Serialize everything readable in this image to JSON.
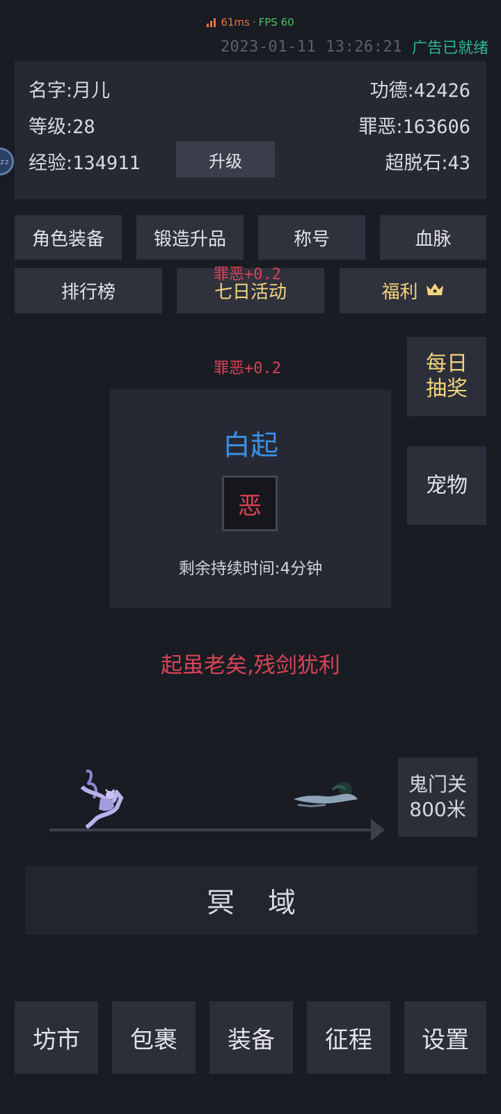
{
  "status": {
    "ping": "61ms",
    "separator": "·",
    "fps": "FPS 60",
    "datetime": "2023-01-11 13:26:21",
    "ad_status": "广告已就绪"
  },
  "player": {
    "name_label": "名字:",
    "name": "月儿",
    "level_label": "等级:",
    "level": "28",
    "exp_label": "经验:",
    "exp": "134911",
    "merit_label": "功德:",
    "merit": "42426",
    "sin_label": "罪恶:",
    "sin": "163606",
    "transcend_label": "超脱石:",
    "transcend": "43",
    "upgrade_label": "升级"
  },
  "menu_row1": [
    "角色装备",
    "锻造升品",
    "称号",
    "血脉"
  ],
  "menu_row2": {
    "ranking": "排行榜",
    "seven_day": "七日活动",
    "welfare": "福利"
  },
  "floating": {
    "sin_gain_1": "罪恶+0.2",
    "sin_gain_2": "罪恶+0.2"
  },
  "side": {
    "daily_draw_line1": "每日",
    "daily_draw_line2": "抽奖",
    "pet": "宠物"
  },
  "boss": {
    "name": "白起",
    "tile_char": "恶",
    "remaining": "剩余持续时间:4分钟"
  },
  "quote": "起虽老矣,残剑犹利",
  "journey": {
    "dest_line1": "鬼门关",
    "dest_line2": "800米",
    "realm_label": "冥域"
  },
  "bottom_nav": [
    "坊市",
    "包裹",
    "装备",
    "征程",
    "设置"
  ],
  "colors": {
    "background": "#1a1c23",
    "panel": "#262932",
    "accent_red": "#d94355",
    "accent_blue": "#3a8fe0",
    "gold": "#f3d47c",
    "green": "#2fb58c"
  }
}
